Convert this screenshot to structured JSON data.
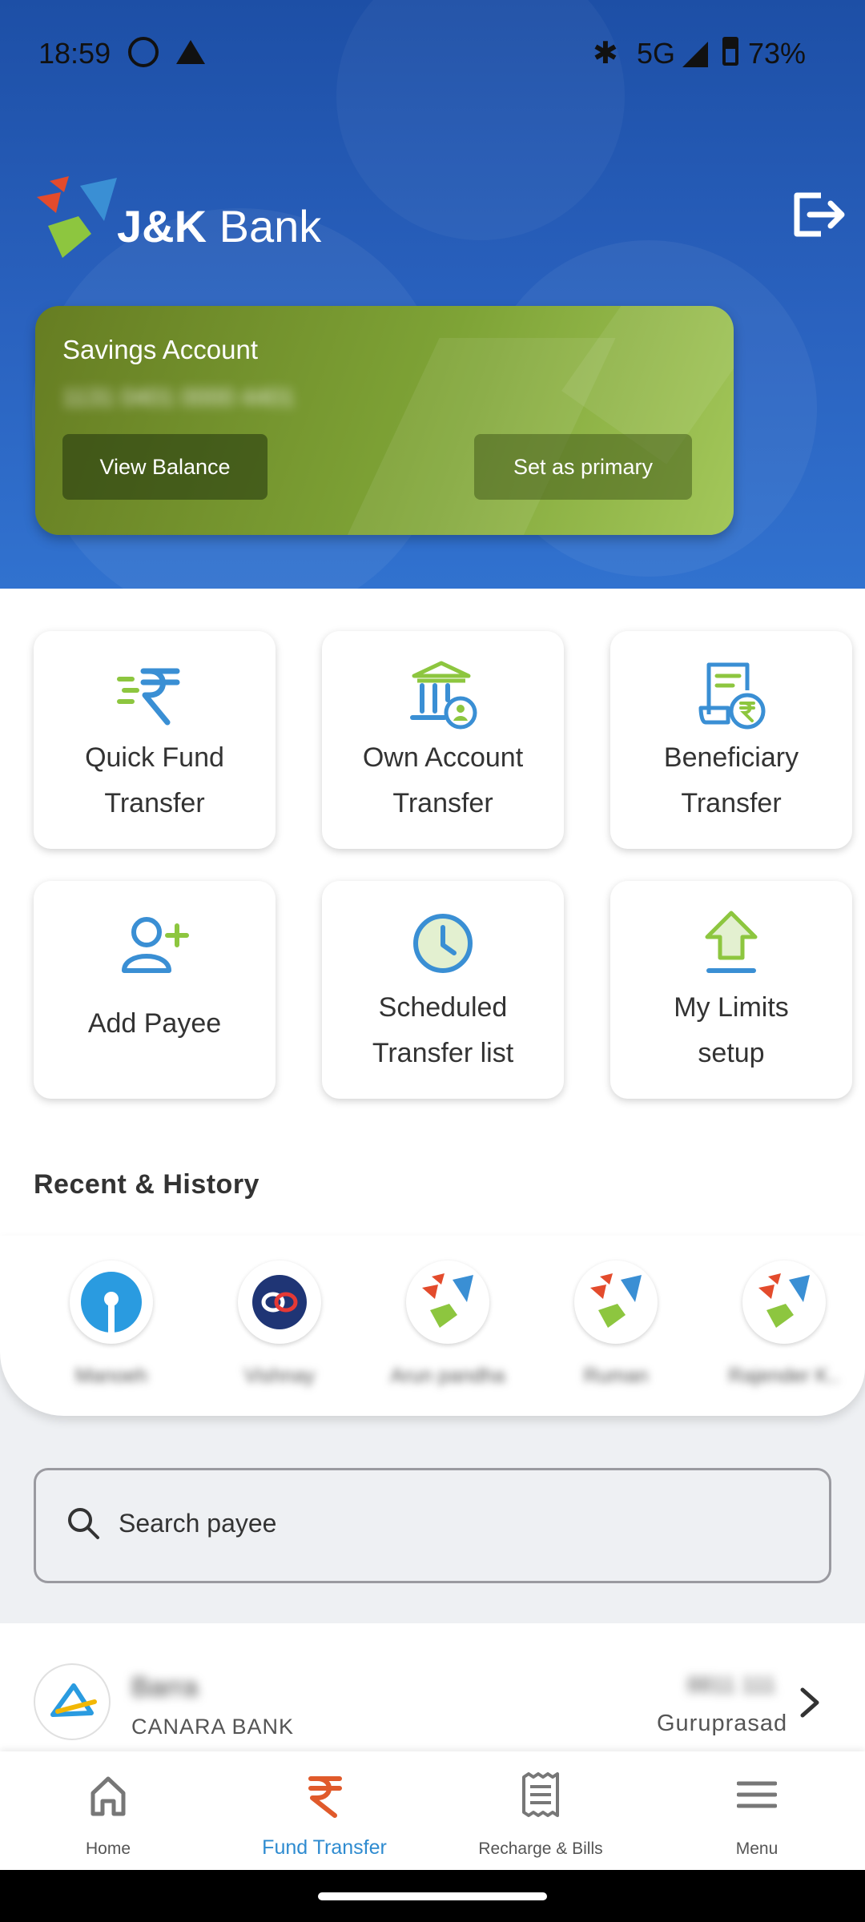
{
  "status_bar": {
    "time": "18:59",
    "network": "5G",
    "battery": "73%"
  },
  "header": {
    "brand": "J&K Bank"
  },
  "account_card": {
    "title": "Savings Account",
    "number_masked": "1131 0401 0000 4401",
    "view_balance_label": "View Balance",
    "set_primary_label": "Set as primary"
  },
  "tiles": [
    {
      "line1": "Quick Fund",
      "line2": "Transfer",
      "icon": "rupee-transfer-icon"
    },
    {
      "line1": "Own Account",
      "line2": "Transfer",
      "icon": "bank-user-icon"
    },
    {
      "line1": "Beneficiary",
      "line2": "Transfer",
      "icon": "receipt-rupee-icon"
    },
    {
      "line1": "Add Payee",
      "line2": "",
      "icon": "add-user-icon"
    },
    {
      "line1": "Scheduled",
      "line2": "Transfer list",
      "icon": "clock-icon"
    },
    {
      "line1": "My Limits",
      "line2": "setup",
      "icon": "upload-arrow-icon"
    }
  ],
  "recent": {
    "title": "Recent & History",
    "items": [
      {
        "name": "Manoeh",
        "logo": "sbi-logo"
      },
      {
        "name": "Vishnay",
        "logo": "kotak-logo"
      },
      {
        "name": "Arun pandha",
        "logo": "jk-logo"
      },
      {
        "name": "Ruman",
        "logo": "jk-logo"
      },
      {
        "name": "Rajender K..",
        "logo": "jk-logo"
      }
    ]
  },
  "search": {
    "placeholder": "Search payee"
  },
  "payee": {
    "name": "Barra",
    "bank": "CANARA BANK",
    "account": "8811 111",
    "branch": "Guruprasad"
  },
  "bottom_nav": [
    {
      "label": "Home",
      "icon": "home-icon",
      "active": false
    },
    {
      "label": "Fund Transfer",
      "icon": "rupee-icon",
      "active": true
    },
    {
      "label": "Recharge & Bills",
      "icon": "receipt-icon",
      "active": false
    },
    {
      "label": "Menu",
      "icon": "menu-icon",
      "active": false
    }
  ],
  "colors": {
    "header_blue": "#2a62bf",
    "card_green": "#7ea336",
    "icon_blue": "#3a8fd4",
    "icon_green": "#8dc63f",
    "active_nav": "#2e8bd0",
    "rupee_red": "#e05a2b"
  }
}
